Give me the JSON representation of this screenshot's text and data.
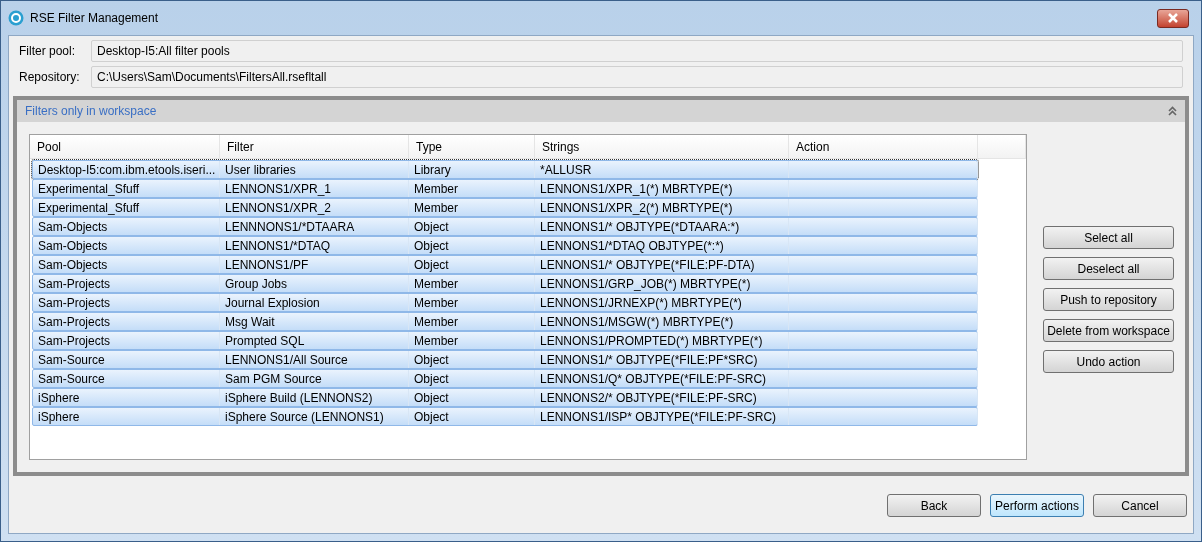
{
  "window": {
    "title": "RSE Filter Management"
  },
  "fields": [
    {
      "label": "Filter pool:",
      "value": "Desktop-I5:All filter pools"
    },
    {
      "label": "Repository:",
      "value": "C:\\Users\\Sam\\Documents\\FiltersAll.rsefltall"
    }
  ],
  "section": {
    "title": "Filters only in workspace",
    "expanded": true
  },
  "table": {
    "columns": [
      "Pool",
      "Filter",
      "Type",
      "Strings",
      "Action"
    ],
    "rows": [
      {
        "cells": [
          "Desktop-I5:com.ibm.etools.iseri...",
          "User libraries",
          "Library",
          "*ALLUSR",
          ""
        ],
        "selected": true,
        "focused": true
      },
      {
        "cells": [
          "Experimental_Sfuff",
          "LENNONS1/XPR_1",
          "Member",
          "LENNONS1/XPR_1(*) MBRTYPE(*)",
          ""
        ],
        "selected": true,
        "focused": false
      },
      {
        "cells": [
          "Experimental_Sfuff",
          "LENNONS1/XPR_2",
          "Member",
          "LENNONS1/XPR_2(*) MBRTYPE(*)",
          ""
        ],
        "selected": true,
        "focused": false
      },
      {
        "cells": [
          "Sam-Objects",
          "LENNNONS1/*DTAARA",
          "Object",
          "LENNONS1/* OBJTYPE(*DTAARA:*)",
          ""
        ],
        "selected": true,
        "focused": false
      },
      {
        "cells": [
          "Sam-Objects",
          "LENNONS1/*DTAQ",
          "Object",
          "LENNONS1/*DTAQ OBJTYPE(*:*)",
          ""
        ],
        "selected": true,
        "focused": false
      },
      {
        "cells": [
          "Sam-Objects",
          "LENNONS1/PF",
          "Object",
          "LENNONS1/* OBJTYPE(*FILE:PF-DTA)",
          ""
        ],
        "selected": true,
        "focused": false
      },
      {
        "cells": [
          "Sam-Projects",
          "Group Jobs",
          "Member",
          "LENNONS1/GRP_JOB(*) MBRTYPE(*)",
          ""
        ],
        "selected": true,
        "focused": false
      },
      {
        "cells": [
          "Sam-Projects",
          "Journal Explosion",
          "Member",
          "LENNONS1/JRNEXP(*) MBRTYPE(*)",
          ""
        ],
        "selected": true,
        "focused": false
      },
      {
        "cells": [
          "Sam-Projects",
          "Msg Wait",
          "Member",
          "LENNONS1/MSGW(*) MBRTYPE(*)",
          ""
        ],
        "selected": true,
        "focused": false
      },
      {
        "cells": [
          "Sam-Projects",
          "Prompted SQL",
          "Member",
          "LENNONS1/PROMPTED(*) MBRTYPE(*)",
          ""
        ],
        "selected": true,
        "focused": false
      },
      {
        "cells": [
          "Sam-Source",
          "LENNONS1/All Source",
          "Object",
          "LENNONS1/* OBJTYPE(*FILE:PF*SRC)",
          ""
        ],
        "selected": true,
        "focused": false
      },
      {
        "cells": [
          "Sam-Source",
          "Sam PGM Source",
          "Object",
          "LENNONS1/Q* OBJTYPE(*FILE:PF-SRC)",
          ""
        ],
        "selected": true,
        "focused": false
      },
      {
        "cells": [
          "iSphere",
          "iSphere Build (LENNONS2)",
          "Object",
          "LENNONS2/* OBJTYPE(*FILE:PF-SRC)",
          ""
        ],
        "selected": true,
        "focused": false
      },
      {
        "cells": [
          "iSphere",
          "iSphere Source (LENNONS1)",
          "Object",
          "LENNONS1/ISP* OBJTYPE(*FILE:PF-SRC)",
          ""
        ],
        "selected": true,
        "focused": false
      }
    ]
  },
  "side_buttons": [
    "Select all",
    "Deselect all",
    "Push to repository",
    "Delete from workspace",
    "Undo action"
  ],
  "footer_buttons": [
    {
      "label": "Back",
      "default": false
    },
    {
      "label": "Perform actions",
      "default": true
    },
    {
      "label": "Cancel",
      "default": false
    }
  ]
}
